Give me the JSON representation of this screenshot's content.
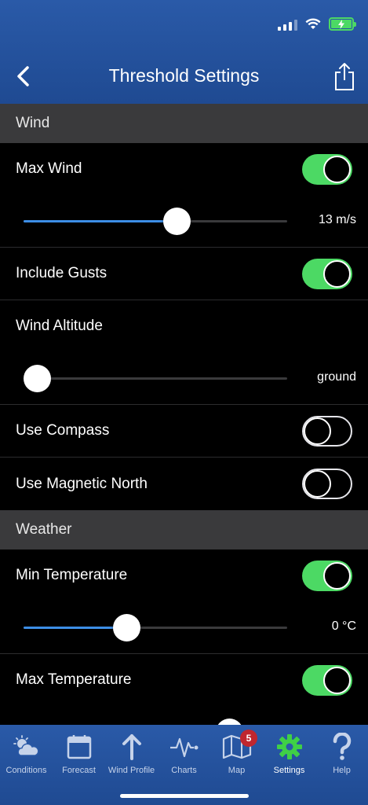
{
  "header": {
    "title": "Threshold Settings",
    "back_icon": "chevron-left-icon",
    "share_icon": "share-icon"
  },
  "colors": {
    "header_blue": "#2a5aa8",
    "toggle_on": "#4cd964",
    "slider_fill": "#3d8ee6",
    "section_bg": "#3a3a3c",
    "badge_red": "#c0262e"
  },
  "sections": {
    "wind": {
      "title": "Wind",
      "max_wind": {
        "label": "Max Wind",
        "enabled": true,
        "value_text": "13 m/s",
        "slider_fraction": 0.58
      },
      "include_gusts": {
        "label": "Include Gusts",
        "enabled": true
      },
      "wind_altitude": {
        "label": "Wind Altitude",
        "value_text": "ground",
        "slider_fraction": 0.05
      },
      "use_compass": {
        "label": "Use Compass",
        "enabled": false
      },
      "use_magnetic_north": {
        "label": "Use Magnetic North",
        "enabled": false
      }
    },
    "weather": {
      "title": "Weather",
      "min_temperature": {
        "label": "Min Temperature",
        "enabled": true,
        "value_text": "0 °C",
        "slider_fraction": 0.39
      },
      "max_temperature": {
        "label": "Max Temperature",
        "enabled": true
      }
    }
  },
  "tabbar": {
    "tabs": [
      {
        "label": "Conditions",
        "icon": "partly-cloudy-icon"
      },
      {
        "label": "Forecast",
        "icon": "calendar-icon"
      },
      {
        "label": "Wind Profile",
        "icon": "arrow-up-icon"
      },
      {
        "label": "Charts",
        "icon": "pulse-chart-icon"
      },
      {
        "label": "Map",
        "icon": "map-icon",
        "badge": "5"
      },
      {
        "label": "Settings",
        "icon": "gear-icon",
        "active": true
      },
      {
        "label": "Help",
        "icon": "question-icon"
      }
    ]
  }
}
